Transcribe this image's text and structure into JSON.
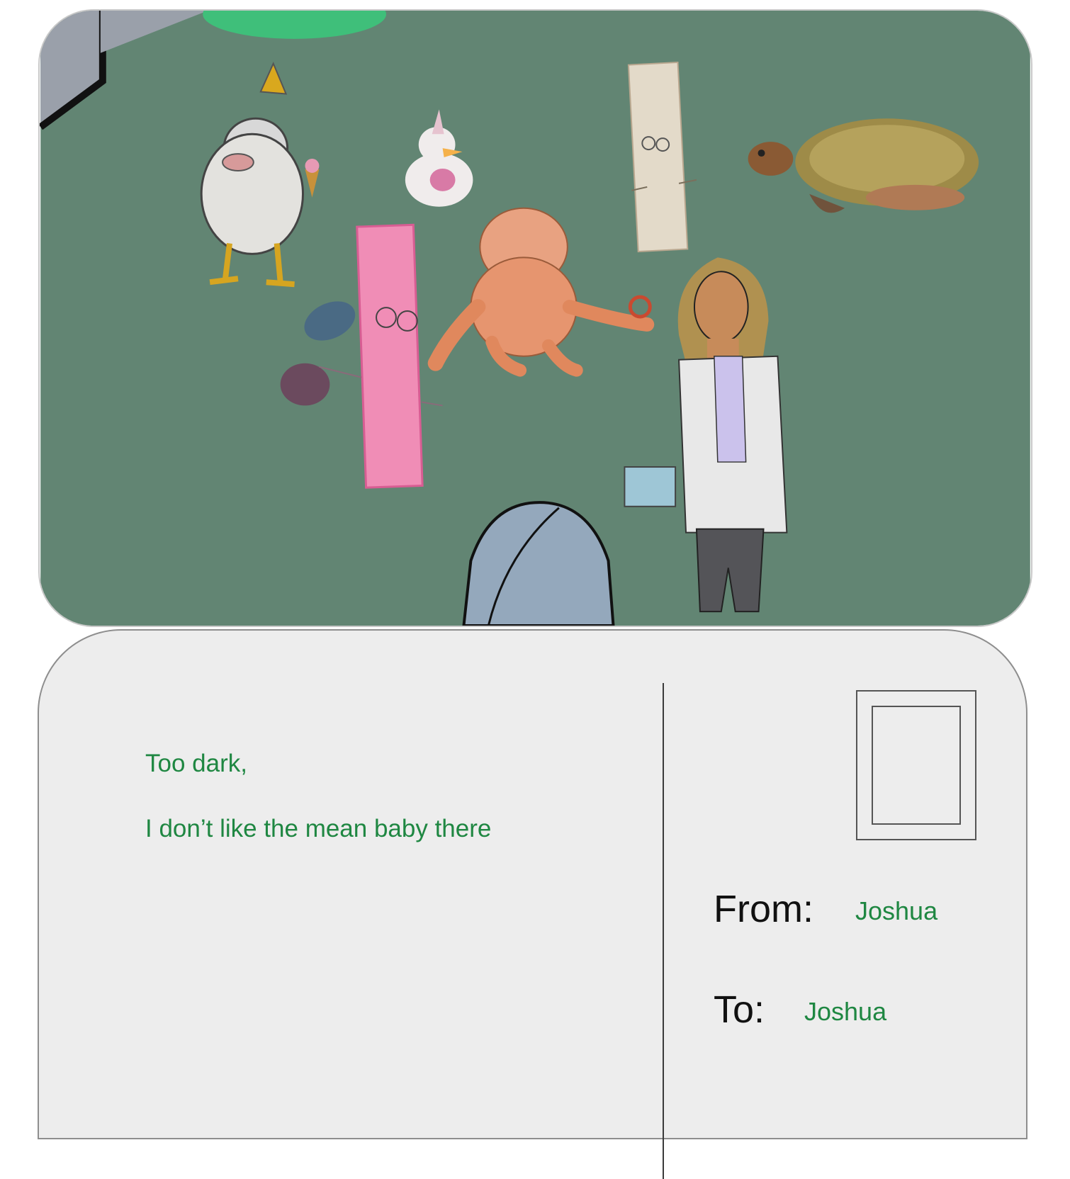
{
  "postcard": {
    "message_line1": "Too dark,",
    "message_line2": "I don’t like the mean baby there",
    "from_label": "From:",
    "from_value": "Joshua",
    "to_label": "To:",
    "to_value": "Joshua"
  },
  "colors": {
    "scene_background": "#628573",
    "card_background": "#ededed",
    "handwriting": "#1f8742"
  }
}
